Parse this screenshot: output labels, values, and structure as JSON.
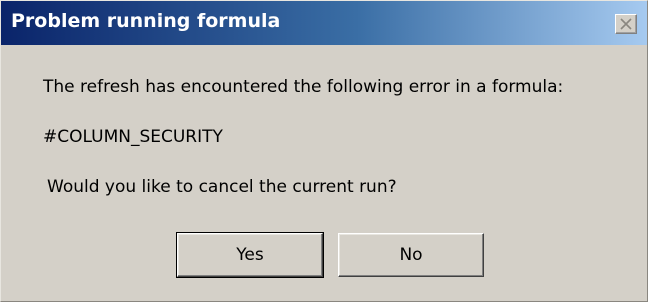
{
  "window": {
    "title": "Problem running formula",
    "close_icon": "close-icon"
  },
  "message": {
    "line1": "The refresh has encountered the following error in a formula:",
    "error_code": "#COLUMN_SECURITY",
    "question": "Would you like to cancel the current run?"
  },
  "buttons": {
    "yes_label": "Yes",
    "no_label": "No"
  },
  "colors": {
    "dialog_background": "#d4d0c8",
    "titlebar_start": "#0a246a",
    "titlebar_end": "#a6caf0",
    "title_text": "#ffffff"
  }
}
